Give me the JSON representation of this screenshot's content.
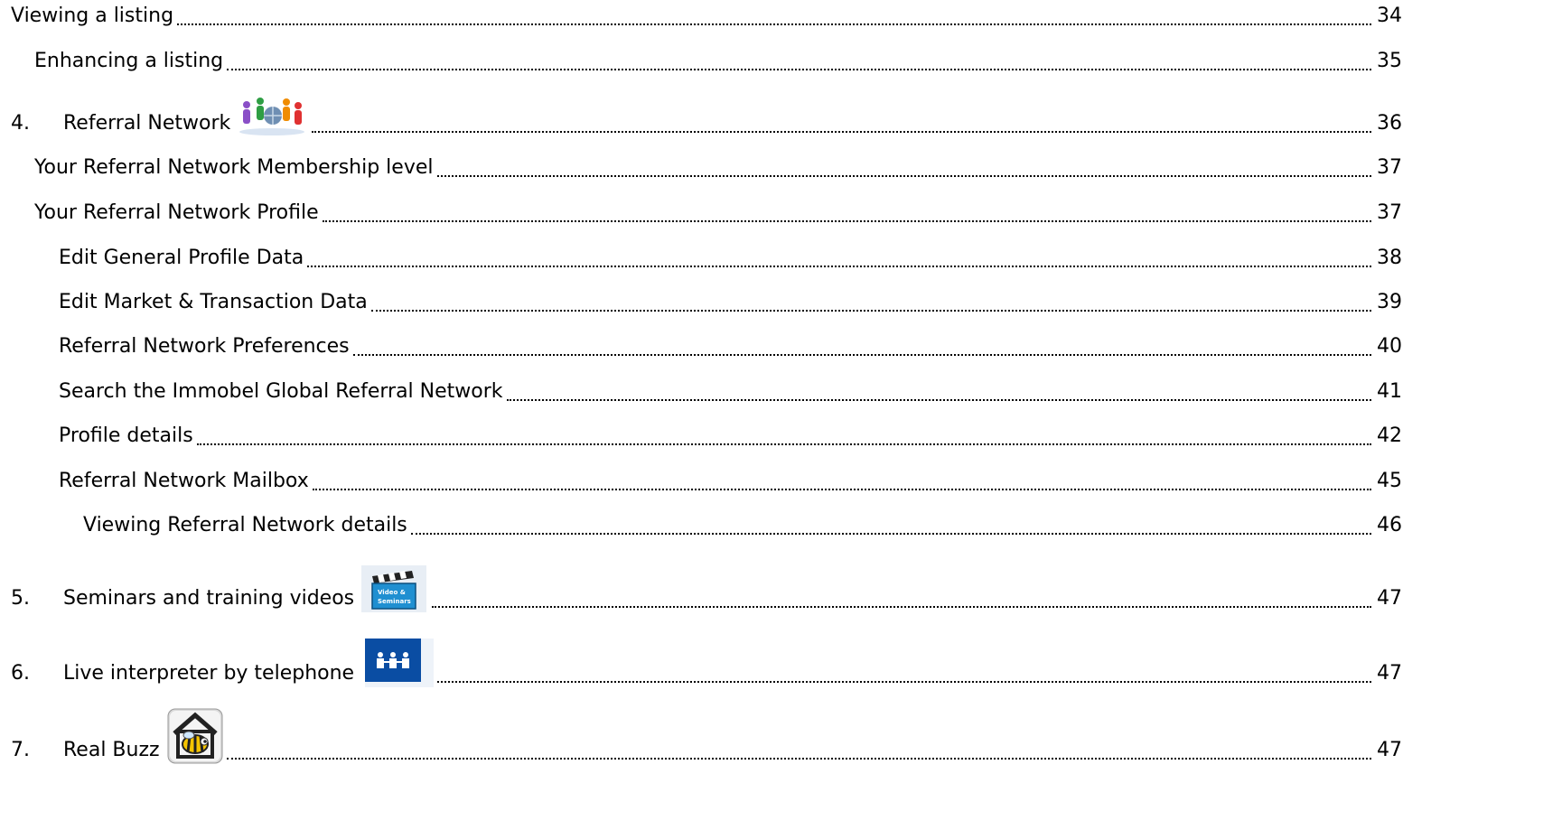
{
  "toc": [
    {
      "level": 1,
      "number": "",
      "title": "Viewing a listing",
      "page": "34"
    },
    {
      "level": 2,
      "number": "",
      "title": "Enhancing a listing",
      "page": "35"
    },
    {
      "level": 1,
      "number": "4.",
      "title": "Referral Network",
      "page": "36",
      "icon": "people-globe-icon"
    },
    {
      "level": 2,
      "number": "",
      "title": "Your Referral Network Membership level",
      "page": "37"
    },
    {
      "level": 2,
      "number": "",
      "title": "Your Referral Network Profile",
      "page": "37"
    },
    {
      "level": 3,
      "number": "",
      "title": "Edit General Profile Data",
      "page": "38"
    },
    {
      "level": 3,
      "number": "",
      "title": "Edit Market & Transaction Data",
      "page": "39"
    },
    {
      "level": 3,
      "number": "",
      "title": "Referral Network Preferences",
      "page": "40"
    },
    {
      "level": 3,
      "number": "",
      "title": "Search the Immobel Global Referral Network",
      "page": "41"
    },
    {
      "level": 3,
      "number": "",
      "title": "Profile details",
      "page": "42"
    },
    {
      "level": 3,
      "number": "",
      "title": "Referral Network Mailbox",
      "page": "45"
    },
    {
      "level": 4,
      "number": "",
      "title": "Viewing Referral Network details",
      "page": "46"
    },
    {
      "level": 1,
      "number": "5.",
      "title": "Seminars and training videos",
      "page": "47",
      "icon": "video-seminars-clapperboard-icon"
    },
    {
      "level": 1,
      "number": "6.",
      "title": "Live interpreter by telephone",
      "page": "47",
      "icon": "interpreter-people-icon"
    },
    {
      "level": 1,
      "number": "7.",
      "title": "Real Buzz",
      "page": "47",
      "icon": "bee-house-icon"
    }
  ],
  "icon_text": {
    "video_icon_line1": "Video &",
    "video_icon_line2": "Seminars"
  },
  "colors": {
    "interpreter_icon_bg": "#0a4da3",
    "video_icon_bg": "#1f8fd1"
  }
}
